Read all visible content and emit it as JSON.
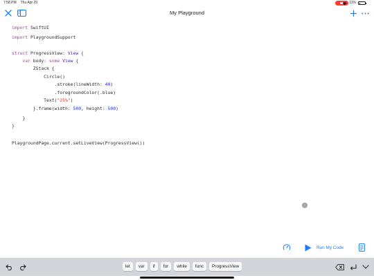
{
  "status_bar": {
    "time": "7:58 PM",
    "date": "Thu Apr 29",
    "battery_text": "11%",
    "battery_level": 0.11,
    "recording_color": "#ff3b30"
  },
  "nav": {
    "title": "My Playground",
    "close_icon": "close-icon",
    "sidebar_icon": "sidebar-icon",
    "add_icon": "plus-icon",
    "more_icon": "ellipsis-icon",
    "accent_color": "#147efb"
  },
  "code": {
    "lines": [
      [
        {
          "t": "import",
          "c": "kw"
        },
        {
          "t": " SwiftUI",
          "c": ""
        }
      ],
      [
        {
          "t": "import",
          "c": "kw"
        },
        {
          "t": " PlaygroundSupport",
          "c": ""
        }
      ],
      [],
      [
        {
          "t": "struct",
          "c": "kw"
        },
        {
          "t": " ProgressView: ",
          "c": ""
        },
        {
          "t": "View",
          "c": "ty"
        },
        {
          "t": " {",
          "c": ""
        }
      ],
      [
        {
          "t": "    ",
          "c": ""
        },
        {
          "t": "var",
          "c": "kw"
        },
        {
          "t": " body: ",
          "c": ""
        },
        {
          "t": "some",
          "c": "kw"
        },
        {
          "t": " ",
          "c": ""
        },
        {
          "t": "View",
          "c": "ty"
        },
        {
          "t": " {",
          "c": ""
        }
      ],
      [
        {
          "t": "        ZStack {",
          "c": ""
        }
      ],
      [
        {
          "t": "            Circle()",
          "c": ""
        }
      ],
      [
        {
          "t": "                .stroke(lineWidth: ",
          "c": ""
        },
        {
          "t": "40",
          "c": "num"
        },
        {
          "t": ")",
          "c": ""
        }
      ],
      [
        {
          "t": "                .foregroundColor(.blue)",
          "c": ""
        }
      ],
      [
        {
          "t": "            Text(",
          "c": ""
        },
        {
          "t": "\"25%\"",
          "c": "str"
        },
        {
          "t": ")",
          "c": ""
        }
      ],
      [
        {
          "t": "        }.frame(width: ",
          "c": ""
        },
        {
          "t": "500",
          "c": "num"
        },
        {
          "t": ", height: ",
          "c": ""
        },
        {
          "t": "500",
          "c": "num"
        },
        {
          "t": ")",
          "c": ""
        }
      ],
      [
        {
          "t": "    }",
          "c": ""
        }
      ],
      [
        {
          "t": "}",
          "c": ""
        }
      ],
      [],
      [
        {
          "t": "PlaygroundPage.current.setLiveView(ProgressView())",
          "c": ""
        }
      ]
    ]
  },
  "run": {
    "speed_icon": "speedometer-icon",
    "run_icon": "play-icon",
    "label": "Run My Code",
    "doc_icon": "document-icon"
  },
  "shortcut_bar": {
    "undo_icon": "undo-icon",
    "redo_icon": "redo-icon",
    "tokens": [
      "let",
      "var",
      "if",
      "for",
      "while",
      "func",
      "ProgressView"
    ],
    "delete_icon": "delete-icon",
    "return_icon": "return-icon",
    "chevron_icon": "chevron-down-icon"
  }
}
